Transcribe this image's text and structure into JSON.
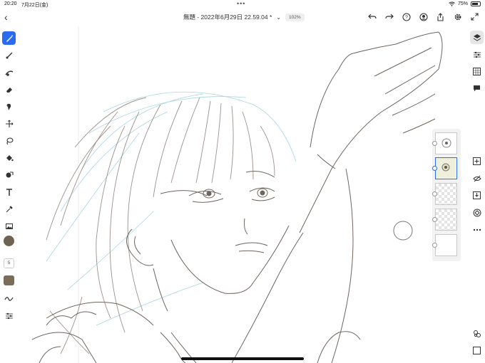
{
  "status_bar": {
    "time": "20:20",
    "date": "7月22日(金)",
    "battery": "75%",
    "dots": "•••"
  },
  "document": {
    "title": "無題 - 2022年6月29日 22.59.04 *",
    "zoom": "102%"
  },
  "toolbar": {
    "back_icon": "chevron-left-icon",
    "right_icons": [
      "undo-icon",
      "redo-icon",
      "help-icon",
      "account-icon",
      "share-icon",
      "settings-icon",
      "fullscreen-icon"
    ]
  },
  "left_tools": {
    "items": [
      "pixel-brush-icon",
      "live-brush-icon",
      "vector-brush-icon",
      "eraser-icon",
      "smudge-icon",
      "transform-icon",
      "lasso-icon",
      "fill-icon",
      "shape-icon",
      "text-icon",
      "eyedropper-icon",
      "image-icon"
    ],
    "brush_size": "5",
    "current_color": "#6e6252",
    "swatch_color": "#7b6b59"
  },
  "right_tools": {
    "items": [
      "layers-icon",
      "layer-properties-icon",
      "grid-icon",
      "comments-icon",
      "add-layer-icon",
      "hide-layer-icon",
      "merge-down-icon",
      "mask-icon",
      "more-icon",
      "link-icon",
      "select-icon"
    ]
  },
  "layers_panel": {
    "count": 5,
    "selected_index": 1
  },
  "colors": {
    "accent": "#2a6cf0",
    "sketch_lines": "#8a7f78",
    "blue_lines": "#9fd0d8"
  }
}
